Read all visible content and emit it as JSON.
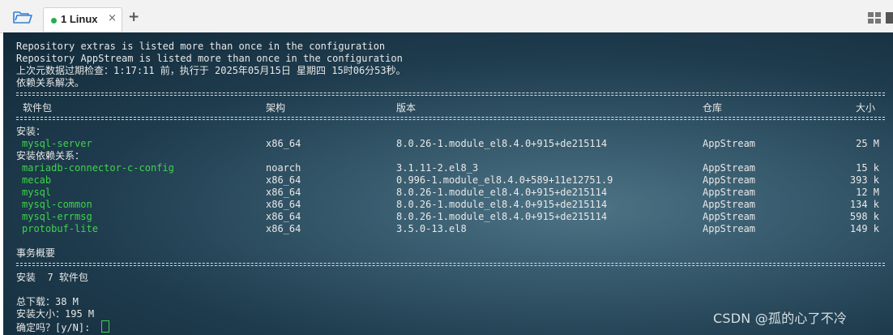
{
  "tabs": [
    {
      "label": "1 Linux",
      "close": "×"
    }
  ],
  "new_tab": "+",
  "icons": {
    "folder": "folder-icon",
    "layout": "grid-layout-icon",
    "status_dot": "#22b14c"
  },
  "terminal": {
    "intro": [
      "Repository extras is listed more than once in the configuration",
      "Repository AppStream is listed more than once in the configuration",
      "上次元数据过期检查：1:17:11 前，执行于 2025年05月15日 星期四 15时06分53秒。",
      "依赖关系解决。"
    ],
    "headers": {
      "package": "软件包",
      "arch": "架构",
      "version": "版本",
      "repo": "仓库",
      "size": "大小"
    },
    "install_label": "安装：",
    "install_rows": [
      {
        "package": "mysql-server",
        "arch": "x86_64",
        "version": "8.0.26-1.module_el8.4.0+915+de215114",
        "repo": "AppStream",
        "size": "25 M"
      }
    ],
    "dep_label": "安装依赖关系：",
    "dep_rows": [
      {
        "package": "mariadb-connector-c-config",
        "arch": "noarch",
        "version": "3.1.11-2.el8_3",
        "repo": "AppStream",
        "size": "15 k"
      },
      {
        "package": "mecab",
        "arch": "x86_64",
        "version": "0.996-1.module_el8.4.0+589+11e12751.9",
        "repo": "AppStream",
        "size": "393 k"
      },
      {
        "package": "mysql",
        "arch": "x86_64",
        "version": "8.0.26-1.module_el8.4.0+915+de215114",
        "repo": "AppStream",
        "size": "12 M"
      },
      {
        "package": "mysql-common",
        "arch": "x86_64",
        "version": "8.0.26-1.module_el8.4.0+915+de215114",
        "repo": "AppStream",
        "size": "134 k"
      },
      {
        "package": "mysql-errmsg",
        "arch": "x86_64",
        "version": "8.0.26-1.module_el8.4.0+915+de215114",
        "repo": "AppStream",
        "size": "598 k"
      },
      {
        "package": "protobuf-lite",
        "arch": "x86_64",
        "version": "3.5.0-13.el8",
        "repo": "AppStream",
        "size": "149 k"
      }
    ],
    "summary_title": "事务概要",
    "summary_install": "安装  7 软件包",
    "total_download": "总下载：38 M",
    "install_size": "安装大小：195 M",
    "prompt": "确定吗？[y/N]: "
  },
  "watermark": "CSDN @孤的心了不冷"
}
